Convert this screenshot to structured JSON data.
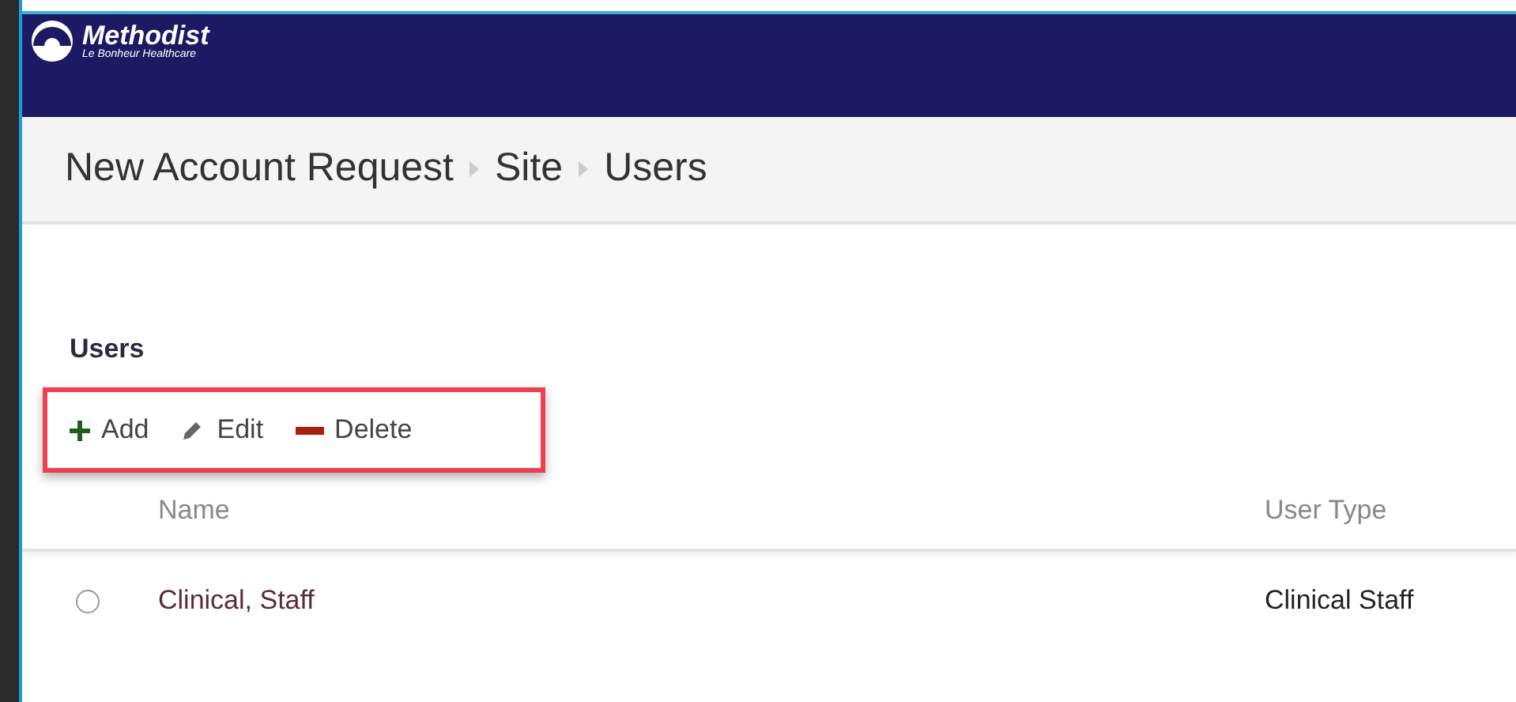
{
  "header": {
    "logo_title": "Methodist",
    "logo_subtitle": "Le Bonheur Healthcare"
  },
  "breadcrumb": [
    "New Account Request",
    "Site",
    "Users"
  ],
  "section_title": "Users",
  "toolbar": [
    {
      "kind": "add",
      "label": "Add"
    },
    {
      "kind": "edit",
      "label": "Edit"
    },
    {
      "kind": "delete",
      "label": "Delete"
    }
  ],
  "table": {
    "columns": [
      "Name",
      "User Type"
    ],
    "rows": [
      {
        "selected": false,
        "name": "Clinical, Staff",
        "user_type": "Clinical Staff"
      }
    ]
  }
}
